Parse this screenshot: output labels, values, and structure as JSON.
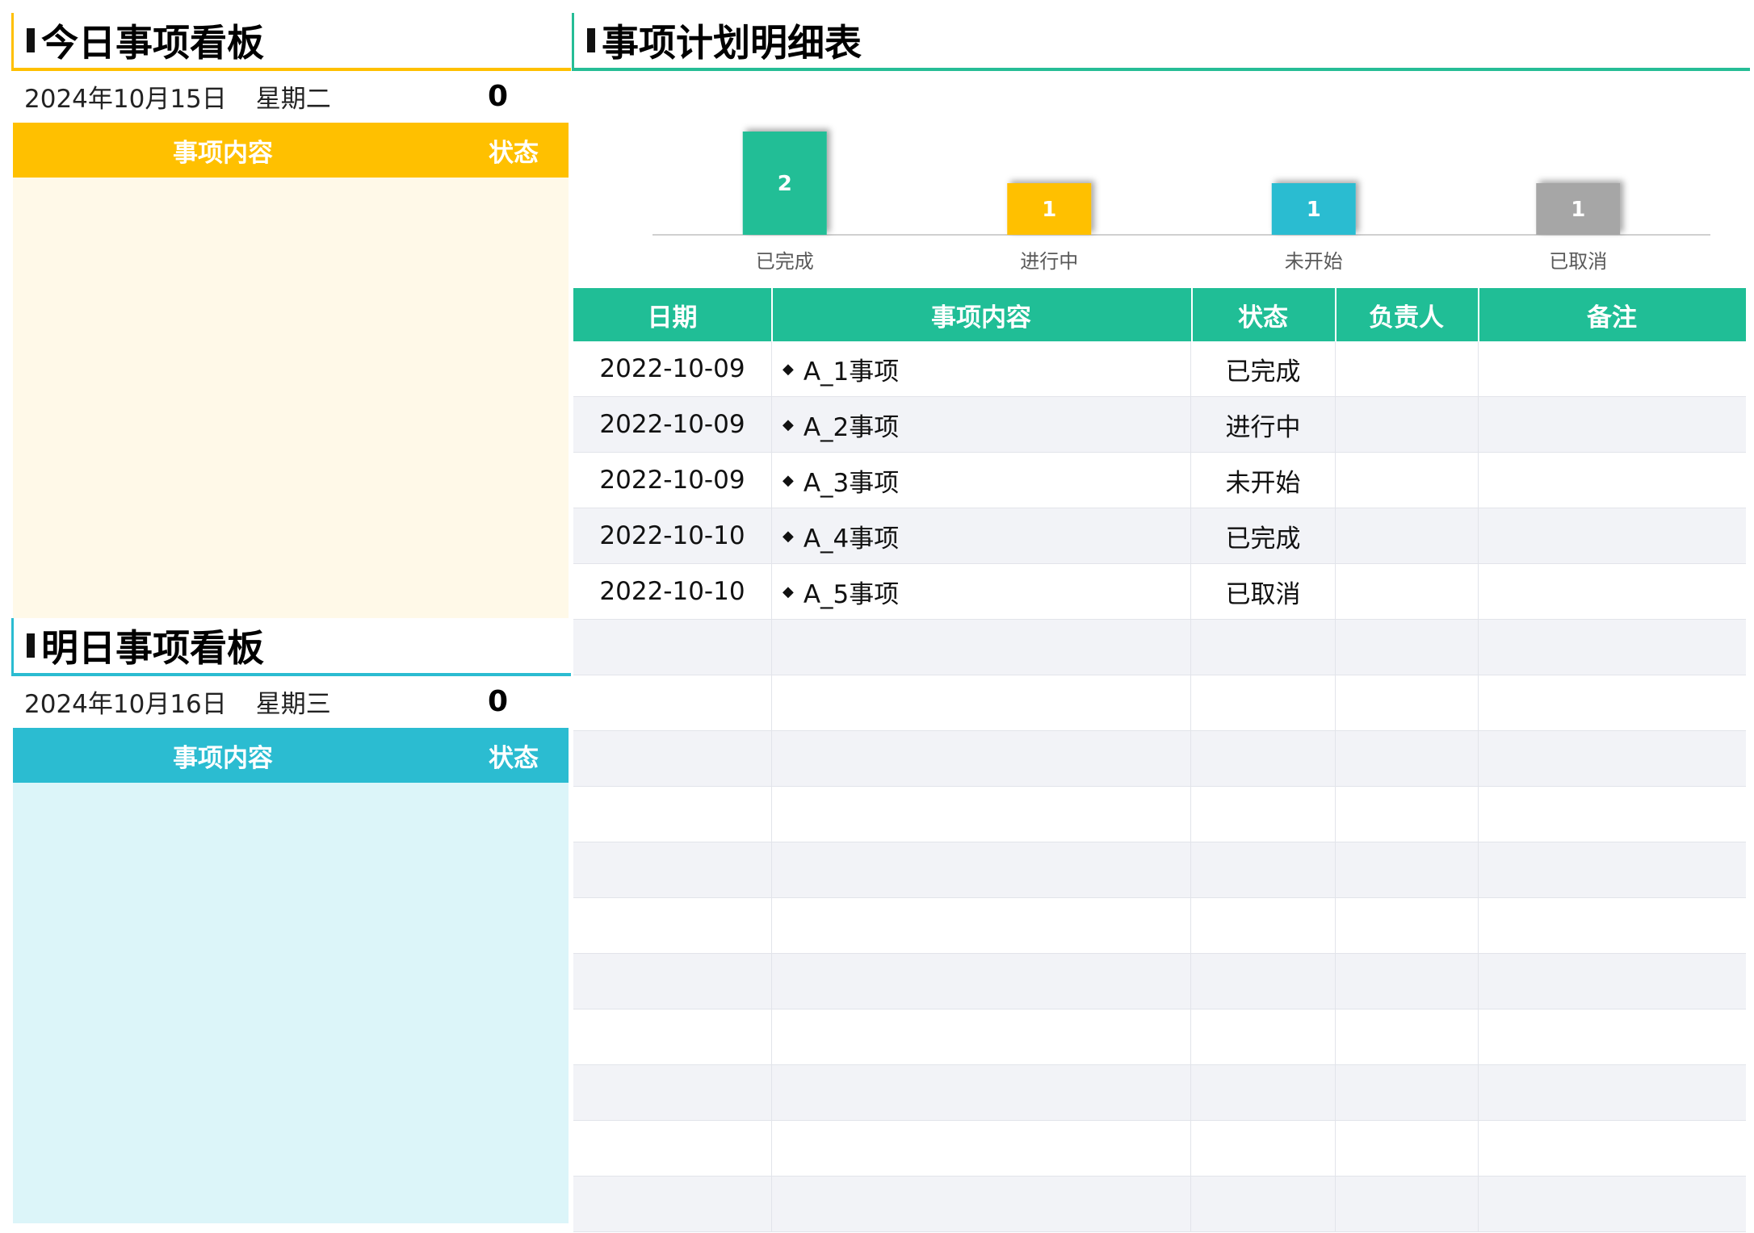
{
  "today_panel": {
    "title": "今日事项看板",
    "date": "2024年10月15日",
    "weekday": "星期二",
    "count": "0",
    "col_content": "事项内容",
    "col_status": "状态",
    "accent": "#FFC000"
  },
  "tomorrow_panel": {
    "title": "明日事项看板",
    "date": "2024年10月16日",
    "weekday": "星期三",
    "count": "0",
    "col_content": "事项内容",
    "col_status": "状态",
    "accent": "#2BBCD1"
  },
  "main": {
    "title": "事项计划明细表",
    "columns": [
      "日期",
      "事项内容",
      "状态",
      "负责人",
      "备注"
    ],
    "rows": [
      {
        "date": "2022-10-09",
        "item": "A_1事项",
        "status": "已完成",
        "owner": "",
        "note": ""
      },
      {
        "date": "2022-10-09",
        "item": "A_2事项",
        "status": "进行中",
        "owner": "",
        "note": ""
      },
      {
        "date": "2022-10-09",
        "item": "A_3事项",
        "status": "未开始",
        "owner": "",
        "note": ""
      },
      {
        "date": "2022-10-10",
        "item": "A_4事项",
        "status": "已完成",
        "owner": "",
        "note": ""
      },
      {
        "date": "2022-10-10",
        "item": "A_5事项",
        "status": "已取消",
        "owner": "",
        "note": ""
      },
      {
        "date": "",
        "item": "",
        "status": "",
        "owner": "",
        "note": ""
      },
      {
        "date": "",
        "item": "",
        "status": "",
        "owner": "",
        "note": ""
      },
      {
        "date": "",
        "item": "",
        "status": "",
        "owner": "",
        "note": ""
      },
      {
        "date": "",
        "item": "",
        "status": "",
        "owner": "",
        "note": ""
      },
      {
        "date": "",
        "item": "",
        "status": "",
        "owner": "",
        "note": ""
      },
      {
        "date": "",
        "item": "",
        "status": "",
        "owner": "",
        "note": ""
      },
      {
        "date": "",
        "item": "",
        "status": "",
        "owner": "",
        "note": ""
      },
      {
        "date": "",
        "item": "",
        "status": "",
        "owner": "",
        "note": ""
      },
      {
        "date": "",
        "item": "",
        "status": "",
        "owner": "",
        "note": ""
      },
      {
        "date": "",
        "item": "",
        "status": "",
        "owner": "",
        "note": ""
      },
      {
        "date": "",
        "item": "",
        "status": "",
        "owner": "",
        "note": ""
      }
    ],
    "header_color": "#20BE96",
    "alt_row_color": "#F2F3F7"
  },
  "chart_data": {
    "type": "bar",
    "categories": [
      "已完成",
      "进行中",
      "未开始",
      "已取消"
    ],
    "values": [
      2,
      1,
      1,
      1
    ],
    "colors": [
      "#20BE96",
      "#FFC000",
      "#2BBCD1",
      "#A6A6A6"
    ],
    "ylim": [
      0,
      2
    ],
    "grid": false,
    "legend": "none"
  }
}
